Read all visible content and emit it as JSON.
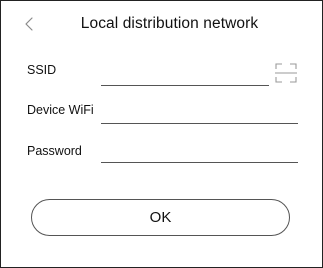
{
  "header": {
    "back_icon": "chevron-left-icon",
    "title": "Local distribution network"
  },
  "form": {
    "ssid": {
      "label": "SSID",
      "value": "",
      "scan_icon": "scan-frame-icon"
    },
    "device_wifi": {
      "label": "Device WiFi",
      "value": ""
    },
    "password": {
      "label": "Password",
      "value": ""
    }
  },
  "actions": {
    "ok_label": "OK"
  },
  "colors": {
    "text": "#111111",
    "line": "#555555",
    "icon": "#9a9a9a",
    "background": "#ffffff"
  }
}
